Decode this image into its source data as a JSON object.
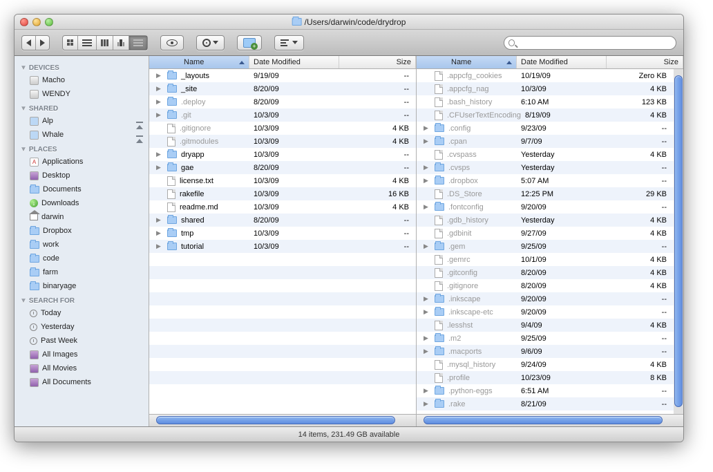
{
  "window": {
    "title": "/Users/darwin/code/drydrop"
  },
  "sidebar": {
    "sections": [
      {
        "header": "DEVICES",
        "items": [
          {
            "label": "Macho",
            "icon": "hd"
          },
          {
            "label": "WENDY",
            "icon": "hd"
          }
        ]
      },
      {
        "header": "SHARED",
        "items": [
          {
            "label": "Alp",
            "icon": "monitor",
            "eject": true
          },
          {
            "label": "Whale",
            "icon": "monitor",
            "eject": true
          }
        ]
      },
      {
        "header": "PLACES",
        "items": [
          {
            "label": "Applications",
            "icon": "apps"
          },
          {
            "label": "Desktop",
            "icon": "desktop"
          },
          {
            "label": "Documents",
            "icon": "folder"
          },
          {
            "label": "Downloads",
            "icon": "download"
          },
          {
            "label": "darwin",
            "icon": "home"
          },
          {
            "label": "Dropbox",
            "icon": "folder"
          },
          {
            "label": "work",
            "icon": "folder"
          },
          {
            "label": "code",
            "icon": "folder"
          },
          {
            "label": "farm",
            "icon": "folder"
          },
          {
            "label": "binaryage",
            "icon": "folder"
          }
        ]
      },
      {
        "header": "SEARCH FOR",
        "items": [
          {
            "label": "Today",
            "icon": "clock"
          },
          {
            "label": "Yesterday",
            "icon": "clock"
          },
          {
            "label": "Past Week",
            "icon": "clock"
          },
          {
            "label": "All Images",
            "icon": "purple"
          },
          {
            "label": "All Movies",
            "icon": "purple"
          },
          {
            "label": "All Documents",
            "icon": "purple"
          }
        ]
      }
    ]
  },
  "columns": {
    "name": "Name",
    "date": "Date Modified",
    "size": "Size"
  },
  "left_pane": {
    "rows": [
      {
        "name": "_layouts",
        "icon": "folder",
        "date": "9/19/09",
        "size": "--",
        "dim": false,
        "exp": true
      },
      {
        "name": "_site",
        "icon": "folder",
        "date": "8/20/09",
        "size": "--",
        "dim": false,
        "exp": true
      },
      {
        "name": ".deploy",
        "icon": "folder",
        "date": "8/20/09",
        "size": "--",
        "dim": true,
        "exp": true
      },
      {
        "name": ".git",
        "icon": "folder",
        "date": "10/3/09",
        "size": "--",
        "dim": true,
        "exp": true
      },
      {
        "name": ".gitignore",
        "icon": "file",
        "date": "10/3/09",
        "size": "4 KB",
        "dim": true,
        "exp": false
      },
      {
        "name": ".gitmodules",
        "icon": "file",
        "date": "10/3/09",
        "size": "4 KB",
        "dim": true,
        "exp": false
      },
      {
        "name": "dryapp",
        "icon": "folder",
        "date": "10/3/09",
        "size": "--",
        "dim": false,
        "exp": true
      },
      {
        "name": "gae",
        "icon": "folder",
        "date": "8/20/09",
        "size": "--",
        "dim": false,
        "exp": true
      },
      {
        "name": "license.txt",
        "icon": "file",
        "date": "10/3/09",
        "size": "4 KB",
        "dim": false,
        "exp": false
      },
      {
        "name": "rakefile",
        "icon": "file",
        "date": "10/3/09",
        "size": "16 KB",
        "dim": false,
        "exp": false
      },
      {
        "name": "readme.md",
        "icon": "file",
        "date": "10/3/09",
        "size": "4 KB",
        "dim": false,
        "exp": false
      },
      {
        "name": "shared",
        "icon": "folder",
        "date": "8/20/09",
        "size": "--",
        "dim": false,
        "exp": true
      },
      {
        "name": "tmp",
        "icon": "folder",
        "date": "10/3/09",
        "size": "--",
        "dim": false,
        "exp": true
      },
      {
        "name": "tutorial",
        "icon": "folder",
        "date": "10/3/09",
        "size": "--",
        "dim": false,
        "exp": true
      }
    ]
  },
  "right_pane": {
    "rows": [
      {
        "name": ".appcfg_cookies",
        "icon": "file",
        "date": "10/19/09",
        "size": "Zero KB"
      },
      {
        "name": ".appcfg_nag",
        "icon": "file",
        "date": "10/3/09",
        "size": "4 KB"
      },
      {
        "name": ".bash_history",
        "icon": "file",
        "date": "6:10 AM",
        "size": "123 KB"
      },
      {
        "name": ".CFUserTextEncoding",
        "icon": "file",
        "date": "8/19/09",
        "size": "4 KB"
      },
      {
        "name": ".config",
        "icon": "folder",
        "date": "9/23/09",
        "size": "--"
      },
      {
        "name": ".cpan",
        "icon": "folder",
        "date": "9/7/09",
        "size": "--"
      },
      {
        "name": ".cvspass",
        "icon": "file",
        "date": "Yesterday",
        "size": "4 KB"
      },
      {
        "name": ".cvsps",
        "icon": "folder",
        "date": "Yesterday",
        "size": "--"
      },
      {
        "name": ".dropbox",
        "icon": "folder",
        "date": "5:07 AM",
        "size": "--"
      },
      {
        "name": ".DS_Store",
        "icon": "file",
        "date": "12:25 PM",
        "size": "29 KB"
      },
      {
        "name": ".fontconfig",
        "icon": "folder",
        "date": "9/20/09",
        "size": "--"
      },
      {
        "name": ".gdb_history",
        "icon": "file",
        "date": "Yesterday",
        "size": "4 KB"
      },
      {
        "name": ".gdbinit",
        "icon": "file",
        "date": "9/27/09",
        "size": "4 KB"
      },
      {
        "name": ".gem",
        "icon": "folder",
        "date": "9/25/09",
        "size": "--"
      },
      {
        "name": ".gemrc",
        "icon": "file",
        "date": "10/1/09",
        "size": "4 KB"
      },
      {
        "name": ".gitconfig",
        "icon": "file",
        "date": "8/20/09",
        "size": "4 KB"
      },
      {
        "name": ".gitignore",
        "icon": "file",
        "date": "8/20/09",
        "size": "4 KB"
      },
      {
        "name": ".inkscape",
        "icon": "folder",
        "date": "9/20/09",
        "size": "--"
      },
      {
        "name": ".inkscape-etc",
        "icon": "folder",
        "date": "9/20/09",
        "size": "--"
      },
      {
        "name": ".lesshst",
        "icon": "file",
        "date": "9/4/09",
        "size": "4 KB"
      },
      {
        "name": ".m2",
        "icon": "folder",
        "date": "9/25/09",
        "size": "--"
      },
      {
        "name": ".macports",
        "icon": "folder",
        "date": "9/6/09",
        "size": "--"
      },
      {
        "name": ".mysql_history",
        "icon": "file",
        "date": "9/24/09",
        "size": "4 KB"
      },
      {
        "name": ".profile",
        "icon": "file",
        "date": "10/23/09",
        "size": "8 KB"
      },
      {
        "name": ".python-eggs",
        "icon": "folder",
        "date": "6:51 AM",
        "size": "--"
      },
      {
        "name": ".rake",
        "icon": "folder",
        "date": "8/21/09",
        "size": "--"
      }
    ]
  },
  "status": "14 items, 231.49 GB available"
}
